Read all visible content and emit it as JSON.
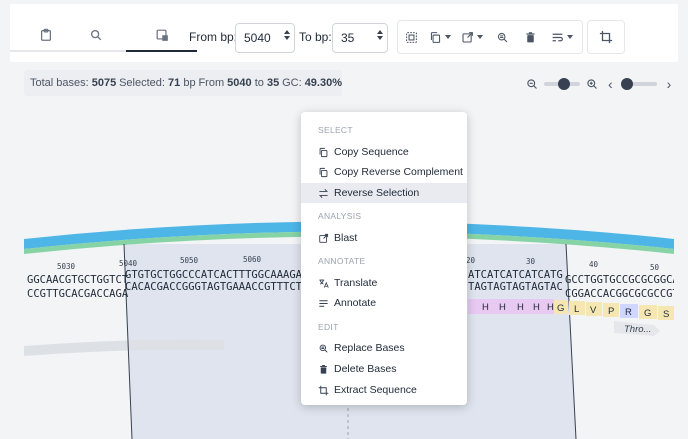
{
  "toolbar": {
    "tabs": [
      {
        "icon": "clipboard-icon"
      },
      {
        "icon": "search-icon"
      },
      {
        "icon": "selection-icon"
      }
    ],
    "from_label": "From bp:",
    "from_value": "5040",
    "to_label": "To bp:",
    "to_value": "35",
    "actions": [
      "select-all-icon",
      "copy-icon",
      "external-link-icon",
      "replace-icon",
      "trash-icon",
      "wrap-icon",
      "crop-icon"
    ]
  },
  "info": {
    "total_label": "Total bases:",
    "total_value": "5075",
    "selected_label": "Selected:",
    "selected_value": "71",
    "selected_unit": "bp",
    "from_label": "From",
    "from_value": "5040",
    "to_label": "to",
    "to_value": "35",
    "gc_label": "GC:",
    "gc_value": "49.30%"
  },
  "zoom": {
    "level_fraction": 0.6,
    "position_fraction": 0.0
  },
  "sequence": {
    "ticks": [
      "5030",
      "5040",
      "5050",
      "5060",
      "20",
      "30",
      "40",
      "50"
    ],
    "top_left": "GGCAACGTGCTGGTCT",
    "top_selected": "GTGTGCTGGCCCATCACTTTGGCAAAGA",
    "top_right_sel": "ATCATCATCATCATG",
    "top_right": "GCCTGGTGCCGCGCGGCAG",
    "bottom_left": "CCGTTGCACGACCAGA",
    "bottom_selected": "CACACGACCGGGTAGTGAAACCGTTTCT",
    "bottom_right_sel": "TAGTAGTAGTAGTAC",
    "bottom_right": "CGGACCACGGCGCGCCGTC",
    "amino_acids": [
      "H",
      "H",
      "H",
      "H",
      "H",
      "G",
      "L",
      "V",
      "P",
      "R",
      "G",
      "S"
    ],
    "feature_label": "Thro..."
  },
  "colors": {
    "backbone_blue": "#4db6e7",
    "backbone_green": "#86d3a5",
    "selection": "#dfe4ee",
    "his_tag": "#e8c9f2",
    "thrombin": "#f6e7b2"
  },
  "context_menu": {
    "select_header": "SELECT",
    "copy_sequence": "Copy Sequence",
    "copy_reverse_complement": "Copy Reverse Complement",
    "reverse_selection": "Reverse Selection",
    "analysis_header": "ANALYSIS",
    "blast": "Blast",
    "annotate_header": "ANNOTATE",
    "translate": "Translate",
    "annotate": "Annotate",
    "edit_header": "EDIT",
    "replace_bases": "Replace Bases",
    "delete_bases": "Delete Bases",
    "extract_sequence": "Extract Sequence"
  }
}
